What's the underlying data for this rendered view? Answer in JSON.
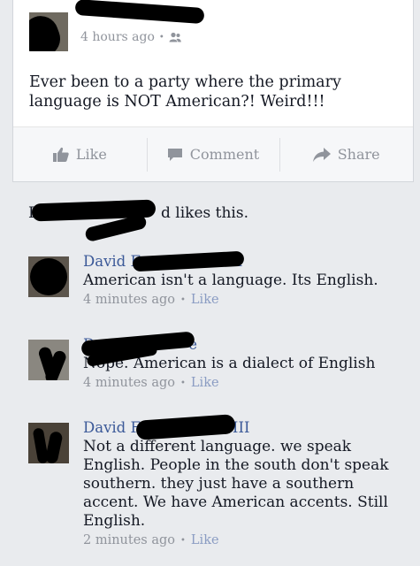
{
  "post": {
    "author_visible": "",
    "timestamp": "4 hours ago",
    "privacy_icon": "friends-icon",
    "text": "Ever been to a party where the primary language is NOT American?!   Weird!!!"
  },
  "actions": {
    "like_label": "Like",
    "comment_label": "Comment",
    "share_label": "Share"
  },
  "likes": {
    "prefix": "D",
    "suffix": "d likes this."
  },
  "comments": [
    {
      "name": "David F",
      "name_tail": "III",
      "text": "American isn't a language. Its English.",
      "time": "4 minutes ago",
      "like_label": "Like"
    },
    {
      "name": "D",
      "name_tail": "e",
      "text": "Nope. American is a dialect of English",
      "time": "4 minutes ago",
      "like_label": "Like"
    },
    {
      "name": "David F",
      "name_tail": "III",
      "text": "Not a different language. we speak English. People in the south don't speak southern. they just have a southern accent. We have American accents. Still English.",
      "time": "2 minutes ago",
      "like_label": "Like"
    }
  ],
  "colors": {
    "link": "#3b5998",
    "muted": "#90949c",
    "background": "#e9ebee"
  }
}
